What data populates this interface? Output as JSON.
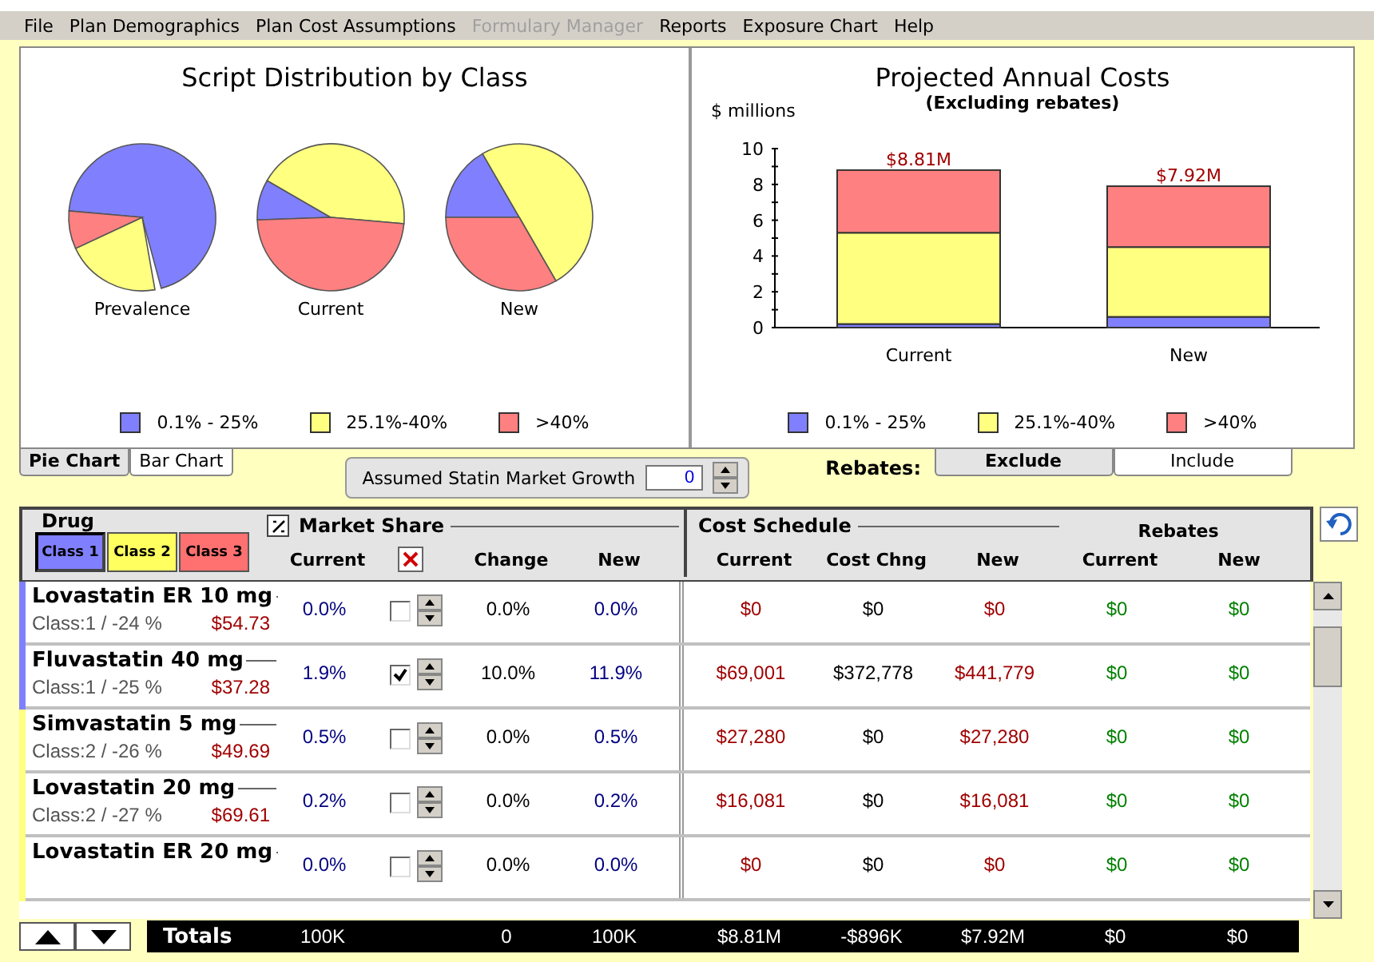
{
  "menu": [
    {
      "label": "File",
      "disabled": false
    },
    {
      "label": "Plan Demographics",
      "disabled": false
    },
    {
      "label": "Plan Cost Assumptions",
      "disabled": false
    },
    {
      "label": "Formulary Manager",
      "disabled": true
    },
    {
      "label": "Reports",
      "disabled": false
    },
    {
      "label": "Exposure Chart",
      "disabled": false
    },
    {
      "label": "Help",
      "disabled": false
    }
  ],
  "pie_panel": {
    "title": "Script Distribution by Class",
    "pies": [
      {
        "label": "Prevalence"
      },
      {
        "label": "Current"
      },
      {
        "label": "New"
      }
    ],
    "legend": [
      {
        "label": "0.1% - 25%",
        "color": "#8080ff"
      },
      {
        "label": "25.1%-40%",
        "color": "#ffff80"
      },
      {
        "label": ">40%",
        "color": "#ff8080"
      }
    ]
  },
  "cost_panel": {
    "subtitle": "(Excluding rebates)",
    "chart_data": {
      "type": "bar",
      "title": "Projected Annual Costs",
      "ylabel": "$ millions",
      "categories": [
        "Current",
        "New"
      ],
      "series": [
        {
          "name": "0.1% - 25%",
          "color": "#8080ff",
          "values": [
            0.2,
            0.6
          ]
        },
        {
          "name": "25.1%-40%",
          "color": "#ffff80",
          "values": [
            5.1,
            3.9
          ]
        },
        {
          "name": ">40%",
          "color": "#ff8080",
          "values": [
            3.5,
            3.4
          ]
        }
      ],
      "ylim": [
        0,
        10
      ],
      "yticks": [
        0,
        2,
        4,
        6,
        8,
        10
      ],
      "stacked": true,
      "annotations": [
        "$8.81M",
        "$7.92M"
      ]
    }
  },
  "chart_tabs": [
    {
      "label": "Pie Chart",
      "selected": true
    },
    {
      "label": "Bar Chart",
      "selected": false
    }
  ],
  "growth": {
    "label": "Assumed Statin Market Growth",
    "value": "0"
  },
  "rebates": {
    "label": "Rebates:",
    "tabs": [
      {
        "label": "Exclude",
        "selected": true
      },
      {
        "label": "Include",
        "selected": false
      }
    ]
  },
  "grid_header": {
    "drug_title": "Drug",
    "classes": [
      {
        "label": "Class 1",
        "color": "#8080ff",
        "selected": true
      },
      {
        "label": "Class 2",
        "color": "#ffff60",
        "selected": false
      },
      {
        "label": "Class 3",
        "color": "#ff7070",
        "selected": false
      }
    ],
    "market_title": "Market Share",
    "market_columns": [
      "Current",
      "Change",
      "New"
    ],
    "cost_title": "Cost Schedule",
    "rebates_group": "Rebates",
    "cost_columns": [
      "Current",
      "Cost Chng",
      "New",
      "Current",
      "New"
    ]
  },
  "rows": [
    {
      "name": "Lovastatin ER 10 mg",
      "class_info": "Class:1 / -24 %",
      "price": "$54.73",
      "color": "#8080ff",
      "current": "0.0%",
      "checked": false,
      "change": "0.0%",
      "new": "0.0%",
      "cost_current": "$0",
      "cost_change": "$0",
      "cost_new": "$0",
      "rebate_current": "$0",
      "rebate_new": "$0"
    },
    {
      "name": "Fluvastatin 40 mg",
      "class_info": "Class:1 / -25 %",
      "price": "$37.28",
      "color": "#8080ff",
      "current": "1.9%",
      "checked": true,
      "change": "10.0%",
      "new": "11.9%",
      "cost_current": "$69,001",
      "cost_change": "$372,778",
      "cost_new": "$441,779",
      "rebate_current": "$0",
      "rebate_new": "$0"
    },
    {
      "name": "Simvastatin 5 mg",
      "class_info": "Class:2 / -26 %",
      "price": "$49.69",
      "color": "#ffff80",
      "current": "0.5%",
      "checked": false,
      "change": "0.0%",
      "new": "0.5%",
      "cost_current": "$27,280",
      "cost_change": "$0",
      "cost_new": "$27,280",
      "rebate_current": "$0",
      "rebate_new": "$0"
    },
    {
      "name": "Lovastatin 20 mg",
      "class_info": "Class:2 / -27 %",
      "price": "$69.61",
      "color": "#ffff80",
      "current": "0.2%",
      "checked": false,
      "change": "0.0%",
      "new": "0.2%",
      "cost_current": "$16,081",
      "cost_change": "$0",
      "cost_new": "$16,081",
      "rebate_current": "$0",
      "rebate_new": "$0"
    },
    {
      "name": "Lovastatin ER 20 mg",
      "color": "#ffff80",
      "current": "0.0%",
      "checked": false,
      "change": "0.0%",
      "new": "0.0%",
      "cost_current": "$0",
      "cost_change": "$0",
      "cost_new": "$0",
      "rebate_current": "$0",
      "rebate_new": "$0"
    }
  ],
  "totals": {
    "label": "Totals",
    "values": [
      "100K",
      "0",
      "100K",
      "$8.81M",
      "-$896K",
      "$7.92M",
      "$0",
      "$0"
    ]
  }
}
